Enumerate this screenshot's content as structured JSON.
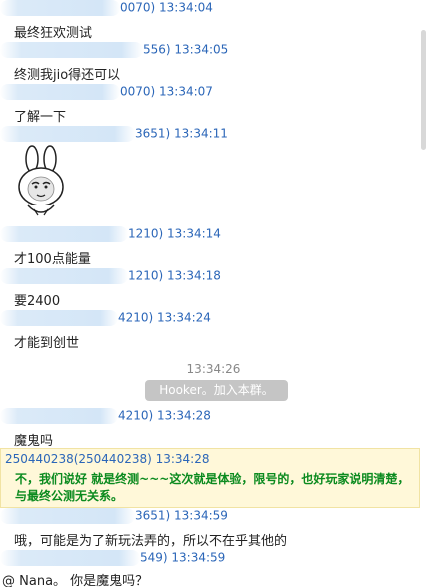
{
  "messages": [
    {
      "id_suffix": "0070) 13:34:04",
      "text": "最终狂欢测试"
    },
    {
      "id_suffix": "556) 13:34:05",
      "text": "终测我jio得还可以"
    },
    {
      "id_suffix": "0070) 13:34:07",
      "text": "了解一下"
    },
    {
      "id_suffix": "3651) 13:34:11",
      "text": ""
    },
    {
      "id_suffix": "1210) 13:34:14",
      "text": "才100点能量"
    },
    {
      "id_suffix": "1210) 13:34:18",
      "text": "要2400"
    },
    {
      "id_suffix": "4210) 13:34:24",
      "text": "才能到创世"
    },
    {
      "id_suffix": "4210) 13:34:28",
      "text": "魔鬼吗"
    },
    {
      "id_suffix": "3651) 13:34:59",
      "text": "哦，可能是为了新玩法弄的，所以不在乎其他的"
    },
    {
      "id_suffix": "549) 13:34:59",
      "text": "@ Nana。 你是魔鬼吗？"
    }
  ],
  "system": {
    "time": "13:34:26",
    "notice": "Hooker。加入本群。"
  },
  "admin": {
    "header": "250440238(250440238) 13:34:28",
    "text": "不，我们说好 就是终测~~~这次就是体验，限号的，也好玩家说明清楚，与最终公测无关系。"
  },
  "sticker": {
    "icon": "bunny-face-sticker"
  },
  "colors": {
    "link_blue": "#2b66b8",
    "admin_green": "#0a8a1e",
    "admin_bg": "#fff8d9",
    "notice_bg": "#c5c5c5"
  }
}
